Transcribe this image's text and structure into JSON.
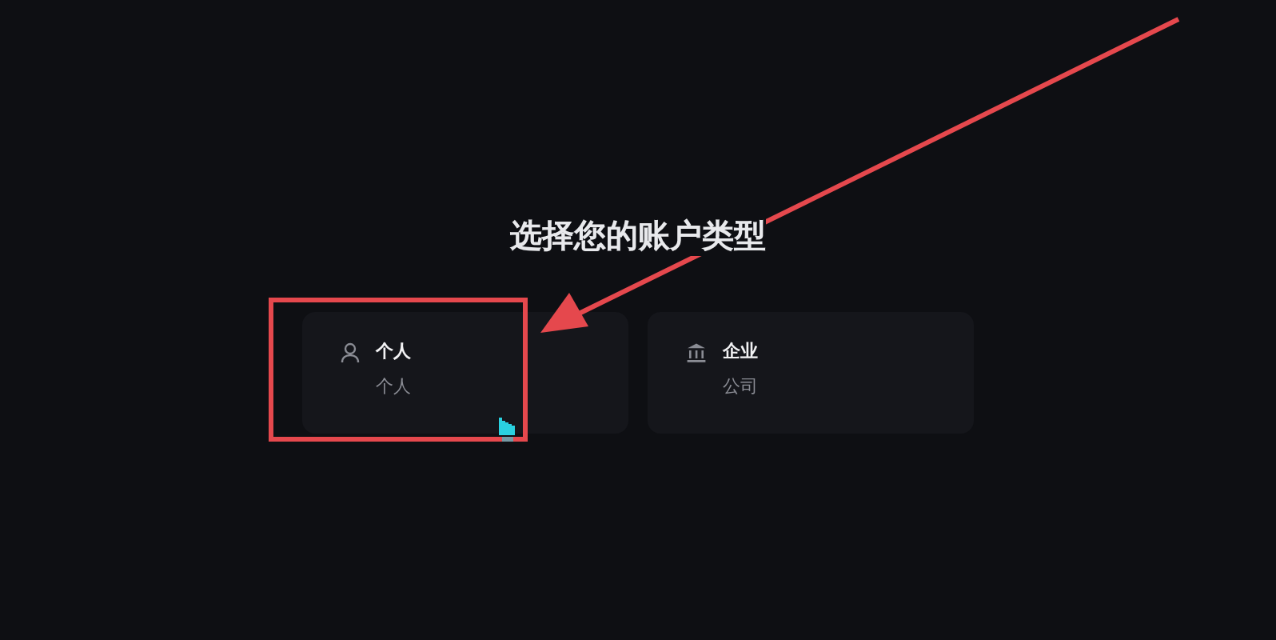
{
  "title": "选择您的账户类型",
  "account_types": [
    {
      "kind": "person",
      "title": "个人",
      "subtitle": "个人"
    },
    {
      "kind": "bank",
      "title": "企业",
      "subtitle": "公司"
    }
  ]
}
